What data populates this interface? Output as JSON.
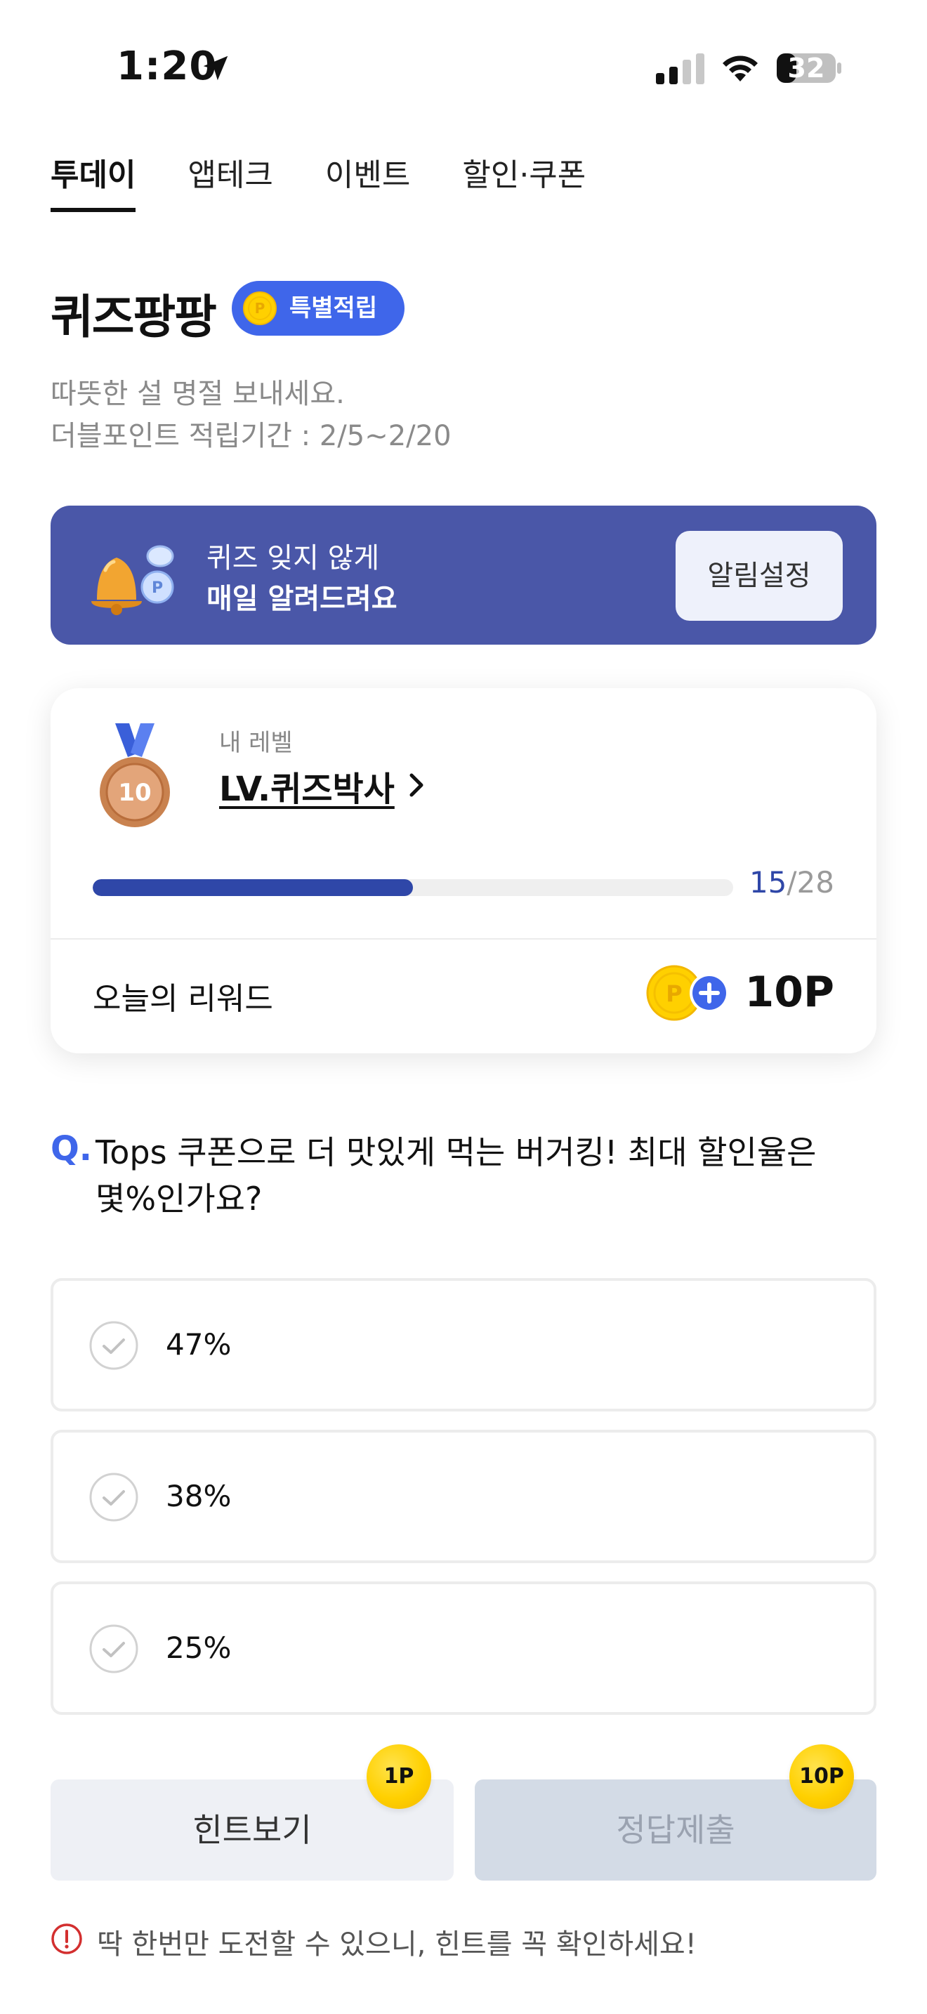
{
  "status_bar": {
    "time": "1:20",
    "battery": "32"
  },
  "tabs": [
    {
      "label": "투데이",
      "active": true
    },
    {
      "label": "앱테크",
      "active": false
    },
    {
      "label": "이벤트",
      "active": false
    },
    {
      "label": "할인·쿠폰",
      "active": false
    }
  ],
  "header": {
    "title": "퀴즈팡팡",
    "badge": "특별적립",
    "subtitle_line1": "따뜻한 설 명절 보내세요.",
    "subtitle_line2": "더블포인트 적립기간 : 2/5~2/20"
  },
  "notice": {
    "line1": "퀴즈 잊지 않게",
    "line2": "매일 알려드려요",
    "button": "알림설정",
    "background": "#4a57a8"
  },
  "level": {
    "label": "내 레벨",
    "name": "LV.퀴즈박사",
    "medal_number": "10",
    "progress_current": "15",
    "progress_total": "/28",
    "progress_fraction": 0.5
  },
  "reward": {
    "label": "오늘의 리워드",
    "value": "10P"
  },
  "question": {
    "mark": "Q.",
    "text": "Tops 쿠폰으로 더 맛있게 먹는 버거킹! 최대 할인율은 몇%인가요?",
    "options": [
      "47%",
      "38%",
      "25%"
    ]
  },
  "buttons": {
    "hint": "힌트보기",
    "hint_cost": "1P",
    "submit": "정답제출",
    "submit_reward": "10P"
  },
  "warning": "딱 한번만 도전할 수 있으니, 힌트를 꼭 확인하세요!",
  "colors": {
    "accent": "#3f66ea",
    "progress": "#2f47a8",
    "coin": "#ffd000",
    "warning": "#d32f2f"
  }
}
